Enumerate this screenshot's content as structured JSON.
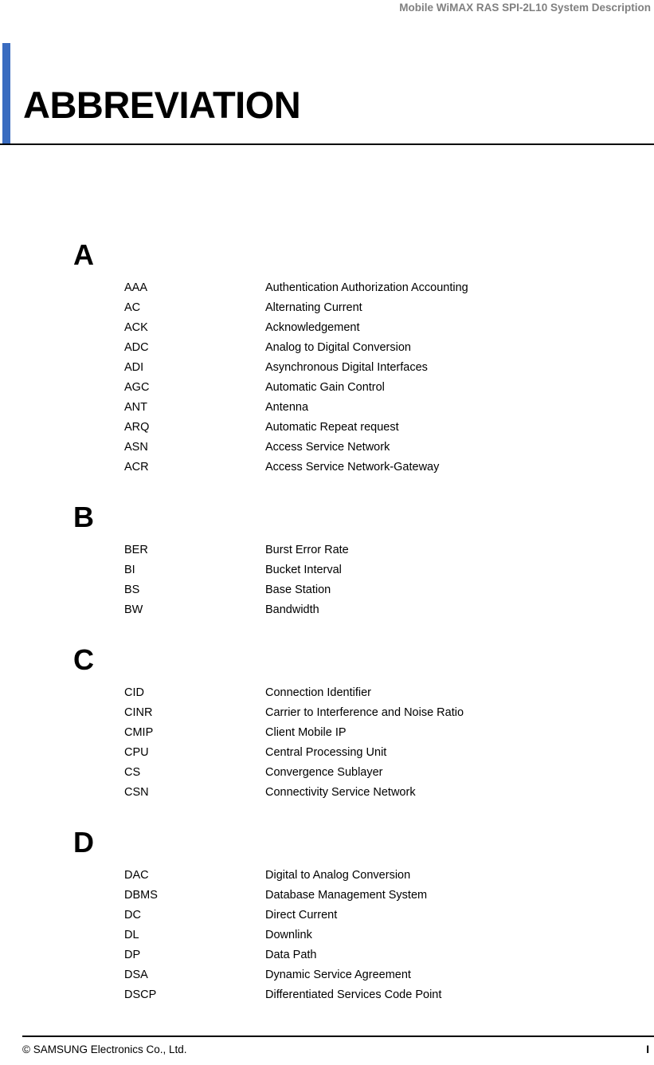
{
  "header": {
    "running_title": "Mobile WiMAX RAS SPI-2L10 System Description"
  },
  "title_block": {
    "chapter_title": "ABBREVIATION",
    "accent_color": "#3a6cc0"
  },
  "glossary": {
    "groups": [
      {
        "letter": "A",
        "entries": [
          {
            "term": "AAA",
            "definition": "Authentication Authorization Accounting"
          },
          {
            "term": "AC",
            "definition": "Alternating Current"
          },
          {
            "term": "ACK",
            "definition": "Acknowledgement"
          },
          {
            "term": "ADC",
            "definition": "Analog to Digital Conversion"
          },
          {
            "term": "ADI",
            "definition": "Asynchronous Digital Interfaces"
          },
          {
            "term": "AGC",
            "definition": "Automatic Gain Control"
          },
          {
            "term": "ANT",
            "definition": "Antenna"
          },
          {
            "term": "ARQ",
            "definition": "Automatic Repeat request"
          },
          {
            "term": "ASN",
            "definition": "Access Service Network"
          },
          {
            "term": "ACR",
            "definition": "Access Service Network-Gateway"
          }
        ]
      },
      {
        "letter": "B",
        "entries": [
          {
            "term": "BER",
            "definition": "Burst Error Rate"
          },
          {
            "term": "BI",
            "definition": "Bucket Interval"
          },
          {
            "term": "BS",
            "definition": "Base Station"
          },
          {
            "term": "BW",
            "definition": "Bandwidth"
          }
        ]
      },
      {
        "letter": "C",
        "entries": [
          {
            "term": "CID",
            "definition": "Connection Identifier"
          },
          {
            "term": "CINR",
            "definition": "Carrier to Interference and Noise Ratio"
          },
          {
            "term": "CMIP",
            "definition": "Client Mobile IP"
          },
          {
            "term": "CPU",
            "definition": "Central Processing Unit"
          },
          {
            "term": "CS",
            "definition": "Convergence Sublayer"
          },
          {
            "term": "CSN",
            "definition": "Connectivity Service Network"
          }
        ]
      },
      {
        "letter": "D",
        "entries": [
          {
            "term": "DAC",
            "definition": "Digital to Analog Conversion"
          },
          {
            "term": "DBMS",
            "definition": "Database Management System"
          },
          {
            "term": "DC",
            "definition": "Direct Current"
          },
          {
            "term": "DL",
            "definition": "Downlink"
          },
          {
            "term": "DP",
            "definition": "Data Path"
          },
          {
            "term": "DSA",
            "definition": "Dynamic Service Agreement"
          },
          {
            "term": "DSCP",
            "definition": "Differentiated Services Code Point"
          }
        ]
      }
    ]
  },
  "footer": {
    "copyright": "© SAMSUNG Electronics Co., Ltd.",
    "page_number": "I"
  }
}
